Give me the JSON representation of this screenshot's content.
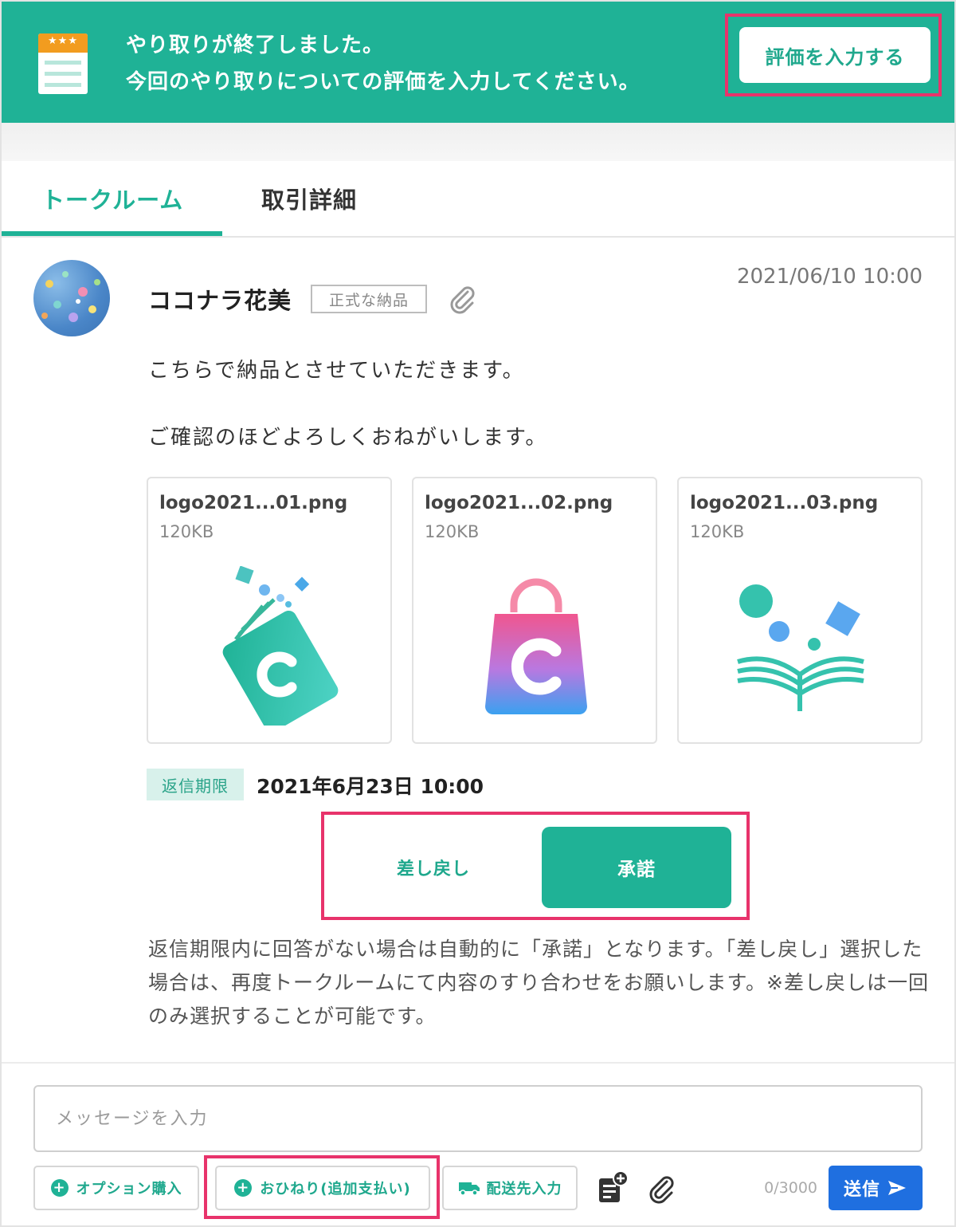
{
  "banner": {
    "line1": "やり取りが終了しました。",
    "line2": "今回のやり取りについての評価を入力してください。",
    "eval_button": "評価を入力する",
    "icon": "rating-sheet-icon",
    "stars": "★★★"
  },
  "tabs": [
    {
      "label": "トークルーム",
      "active": true
    },
    {
      "label": "取引詳細",
      "active": false
    }
  ],
  "message": {
    "sender": "ココナラ花美",
    "badge": "正式な納品",
    "timestamp": "2021/06/10 10:00",
    "body_line1": "こちらで納品とさせていただきます。",
    "body_line2": "ご確認のほどよろしくおねがいします。",
    "files": [
      {
        "name": "logo2021...01.png",
        "size": "120KB",
        "thumb": "book-logo-icon"
      },
      {
        "name": "logo2021...02.png",
        "size": "120KB",
        "thumb": "shopping-bag-logo-icon"
      },
      {
        "name": "logo2021...03.png",
        "size": "120KB",
        "thumb": "open-book-logo-icon"
      }
    ],
    "deadline_label": "返信期限",
    "deadline_value": "2021年6月23日 10:00",
    "reject_button": "差し戻し",
    "accept_button": "承諾",
    "note": "返信期限内に回答がない場合は自動的に「承諾」となります。「差し戻し」選択した場合は、再度トークルームにて内容のすり合わせをお願いします。※差し戻しは一回のみ選択することが可能です。"
  },
  "composer": {
    "placeholder": "メッセージを入力",
    "option_button": "オプション購入",
    "tip_button": "おひねり(追加支払い)",
    "ship_button": "配送先入力",
    "counter": "0/3000",
    "send_button": "送信"
  },
  "colors": {
    "brand": "#1fb296",
    "highlight": "#e8336b",
    "send": "#1f6fe0"
  }
}
